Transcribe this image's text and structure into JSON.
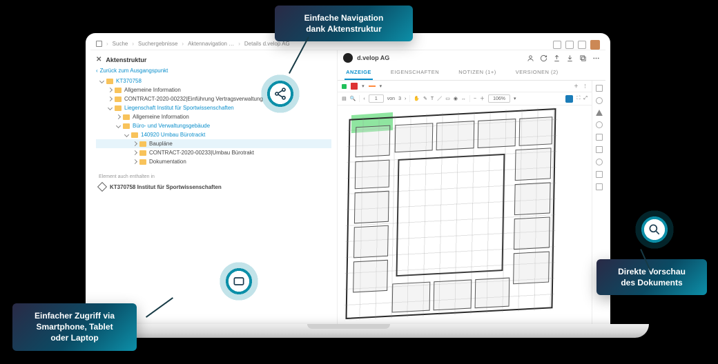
{
  "breadcrumb": {
    "items": [
      "Suche",
      "Suchergebnisse",
      "Aktennavigation …",
      "Details d.velop AG"
    ]
  },
  "left": {
    "title": "Aktenstruktur",
    "back": "Zurück zum Ausgangspunkt",
    "related_label": "Element auch enthalten in",
    "related_item": "KT370758 Institut für Sportwissenschaften"
  },
  "tree": [
    {
      "level": 1,
      "text": "KT370758",
      "link": true,
      "open": true
    },
    {
      "level": 2,
      "text": "Allgemeine Information"
    },
    {
      "level": 2,
      "text": "CONTRACT-2020-00232|Einführung Vertragsverwaltung"
    },
    {
      "level": 2,
      "text": "Liegenschaft Institut für Sportwissenschaften",
      "link": true,
      "open": true
    },
    {
      "level": 3,
      "text": "Allgemeine Information"
    },
    {
      "level": 3,
      "text": "Büro- und Verwaltungsgebäude",
      "link": true,
      "open": true
    },
    {
      "level": 4,
      "text": "140920 Umbau Bürotrackt",
      "link": true,
      "open": true
    },
    {
      "level": 5,
      "text": "Baupläne",
      "selected": true
    },
    {
      "level": 5,
      "text": "CONTRACT-2020-00233|Umbau Bürotrakt"
    },
    {
      "level": 5,
      "text": "Dokumentation"
    }
  ],
  "right": {
    "title": "d.velop AG",
    "tabs": {
      "anzeige": "ANZEIGE",
      "eigenschaften": "EIGENSCHAFTEN",
      "notizen": "NOTIZEN (1+)",
      "versionen": "VERSIONEN (2)"
    },
    "viewer": {
      "page_current": "1",
      "page_sep": "von",
      "page_total": "3",
      "zoom": "106%"
    }
  },
  "callouts": {
    "nav": "Einfache Navigation\ndank Aktenstruktur",
    "preview": "Direkte Vorschau\ndes Dokuments",
    "access": "Einfacher Zugriff via\nSmartphone, Tablet\noder Laptop"
  }
}
